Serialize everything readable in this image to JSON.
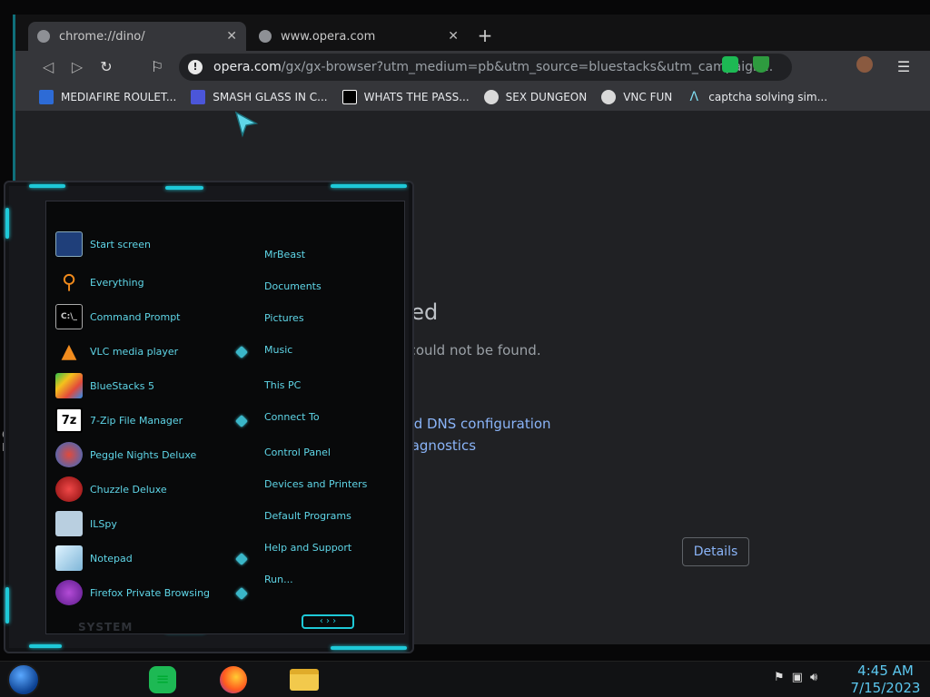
{
  "browser": {
    "tabs": [
      {
        "title": "chrome://dino/",
        "active": true
      },
      {
        "title": "www.opera.com",
        "active": false
      }
    ],
    "omnibox": {
      "domain": "opera.com",
      "path": "/gx/gx-browser?utm_medium=pb&utm_source=bluestacks&utm_campaign..."
    },
    "bookmarks": [
      {
        "label": "MEDIAFIRE ROULET...",
        "icon": "mediafire-icon",
        "color": "#2d6bd6"
      },
      {
        "label": "SMASH GLASS IN C...",
        "icon": "smash-icon",
        "color": "#4b56d9"
      },
      {
        "label": "WHATS THE PASS...",
        "icon": "lock-icon",
        "color": "#ffffff"
      },
      {
        "label": "SEX DUNGEON",
        "icon": "bookmark-icon",
        "color": "#d9d9d9"
      },
      {
        "label": "VNC FUN",
        "icon": "bookmark-icon",
        "color": "#d9d9d9"
      },
      {
        "label": "captcha solving sim...",
        "icon": "captcha-icon",
        "color": "#7fdcf0"
      }
    ],
    "error": {
      "title": "hed",
      "description": "s could not be found.",
      "link1": "and DNS configuration",
      "link2": "Diagnostics",
      "details_button": "Details"
    }
  },
  "start_menu": {
    "programs": [
      {
        "label": "Start screen",
        "icon": "start-screen-icon",
        "has_submenu": false
      },
      {
        "label": "Everything",
        "icon": "search-icon",
        "has_submenu": false
      },
      {
        "label": "Command Prompt",
        "icon": "terminal-icon",
        "has_submenu": false
      },
      {
        "label": "VLC media player",
        "icon": "vlc-icon",
        "has_submenu": true
      },
      {
        "label": "BlueStacks 5",
        "icon": "bluestacks-icon",
        "has_submenu": false
      },
      {
        "label": "7-Zip File Manager",
        "icon": "7zip-icon",
        "has_submenu": true
      },
      {
        "label": "Peggle Nights Deluxe",
        "icon": "peggle-icon",
        "has_submenu": false
      },
      {
        "label": "Chuzzle Deluxe",
        "icon": "chuzzle-icon",
        "has_submenu": false
      },
      {
        "label": "ILSpy",
        "icon": "ilspy-icon",
        "has_submenu": false
      },
      {
        "label": "Notepad",
        "icon": "notepad-icon",
        "has_submenu": true
      },
      {
        "label": "Firefox Private Browsing",
        "icon": "firefox-private-icon",
        "has_submenu": true
      }
    ],
    "places": [
      "MrBeast",
      "Documents",
      "Pictures",
      "Music",
      "This PC",
      "Connect To",
      "Control Panel",
      "Devices and Printers",
      "Default Programs",
      "Help and Support",
      "Run..."
    ],
    "system_label": "SYSTEM"
  },
  "taskbar": {
    "apps": [
      {
        "name": "notes-app",
        "icon": "notes-icon"
      },
      {
        "name": "firefox",
        "icon": "firefox-icon"
      },
      {
        "name": "file-explorer",
        "icon": "folder-icon"
      }
    ],
    "clock": {
      "time": "4:45 AM",
      "date": "7/15/2023"
    }
  },
  "colors": {
    "accent": "#1ec9d8",
    "menu_text": "#5fd6e8",
    "link": "#8ab4f8",
    "clock": "#5cc8f0"
  }
}
